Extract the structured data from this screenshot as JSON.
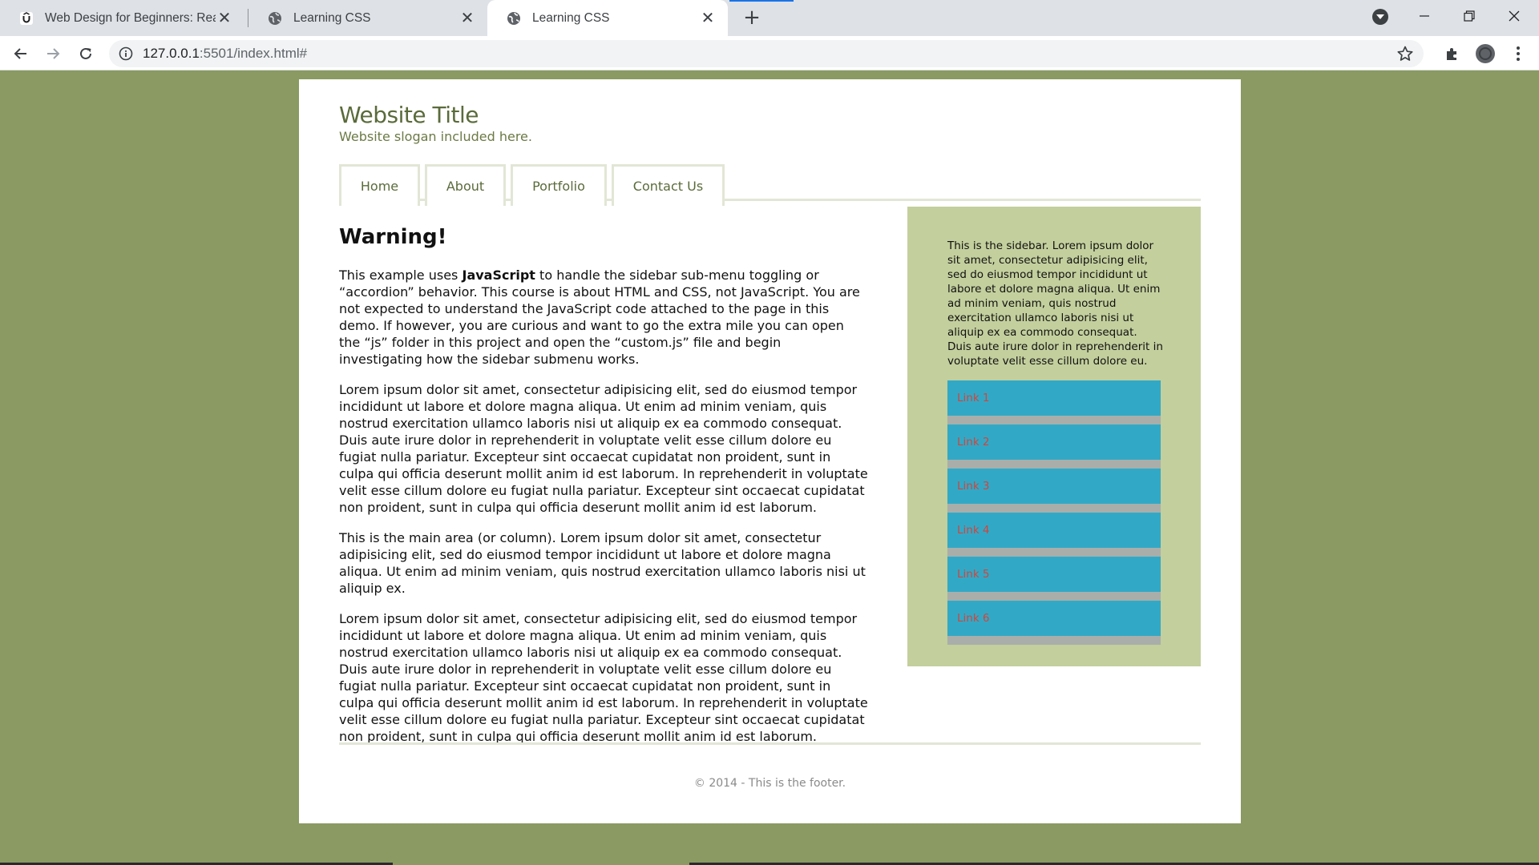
{
  "browser": {
    "tabs": [
      {
        "title": "Web Design for Beginners: Real W",
        "close": "✕",
        "favicon": "udemy-icon"
      },
      {
        "title": "Learning CSS",
        "close": "✕",
        "favicon": "globe-icon"
      },
      {
        "title": "Learning CSS",
        "close": "✕",
        "favicon": "globe-icon",
        "active": true
      }
    ],
    "new_tab": "+",
    "url_host": "127.0.0.1",
    "url_rest": ":5501/index.html#"
  },
  "site": {
    "title": "Website Title",
    "slogan": "Website slogan included here.",
    "nav": [
      "Home",
      "About",
      "Portfolio",
      "Contact Us"
    ]
  },
  "main": {
    "heading": "Warning!",
    "p1_before": "This example uses ",
    "p1_bold": "JavaScript",
    "p1_after": " to handle the sidebar sub-menu toggling or “accordion” behavior. This course is about HTML and CSS, not JavaScript. You are not expected to understand the JavaScript code attached to the page in this demo. If however, you are curious and want to go the extra mile you can open the “js” folder in this project and open the “custom.js” file and begin investigating how the sidebar submenu works.",
    "p2": "Lorem ipsum dolor sit amet, consectetur adipisicing elit, sed do eiusmod tempor incididunt ut labore et dolore magna aliqua. Ut enim ad minim veniam, quis nostrud exercitation ullamco laboris nisi ut aliquip ex ea commodo consequat. Duis aute irure dolor in reprehenderit in voluptate velit esse cillum dolore eu fugiat nulla pariatur. Excepteur sint occaecat cupidatat non proident, sunt in culpa qui officia deserunt mollit anim id est laborum. In reprehenderit in voluptate velit esse cillum dolore eu fugiat nulla pariatur. Excepteur sint occaecat cupidatat non proident, sunt in culpa qui officia deserunt mollit anim id est laborum.",
    "p3": "This is the main area (or column). Lorem ipsum dolor sit amet, consectetur adipisicing elit, sed do eiusmod tempor incididunt ut labore et dolore magna aliqua. Ut enim ad minim veniam, quis nostrud exercitation ullamco laboris nisi ut aliquip ex.",
    "p4": "Lorem ipsum dolor sit amet, consectetur adipisicing elit, sed do eiusmod tempor incididunt ut labore et dolore magna aliqua. Ut enim ad minim veniam, quis nostrud exercitation ullamco laboris nisi ut aliquip ex ea commodo consequat. Duis aute irure dolor in reprehenderit in voluptate velit esse cillum dolore eu fugiat nulla pariatur. Excepteur sint occaecat cupidatat non proident, sunt in culpa qui officia deserunt mollit anim id est laborum. In reprehenderit in voluptate velit esse cillum dolore eu fugiat nulla pariatur. Excepteur sint occaecat cupidatat non proident, sunt in culpa qui officia deserunt mollit anim id est laborum."
  },
  "sidebar": {
    "text": "This is the sidebar. Lorem ipsum dolor sit amet, consectetur adipisicing elit, sed do eiusmod tempor incididunt ut labore et dolore magna aliqua. Ut enim ad minim veniam, quis nostrud exercitation ullamco laboris nisi ut aliquip ex ea commodo consequat. Duis aute irure dolor in reprehenderit in voluptate velit esse cillum dolore eu.",
    "links": [
      "Link 1",
      "Link 2",
      "Link 3",
      "Link 4",
      "Link 5",
      "Link 6"
    ]
  },
  "footer": {
    "text": "© 2014 - This is the footer."
  },
  "colors": {
    "page_background": "#8a9a62",
    "sidebar_background": "#c3cf9d",
    "link_background": "#31a9c6",
    "link_text": "#d6433a",
    "title_text": "#5a6b3a"
  }
}
